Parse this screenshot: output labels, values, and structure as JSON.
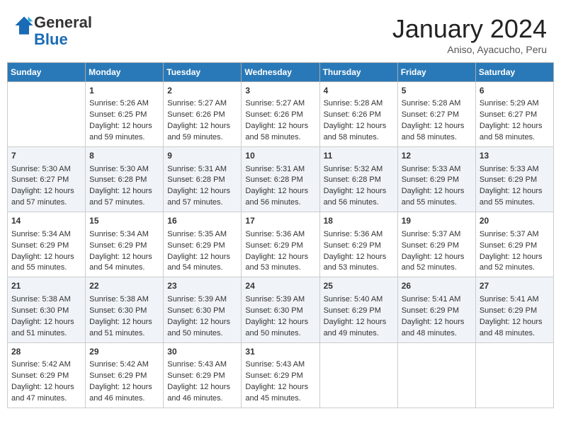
{
  "header": {
    "logo_general": "General",
    "logo_blue": "Blue",
    "month_title": "January 2024",
    "subtitle": "Aniso, Ayacucho, Peru"
  },
  "days_of_week": [
    "Sunday",
    "Monday",
    "Tuesday",
    "Wednesday",
    "Thursday",
    "Friday",
    "Saturday"
  ],
  "weeks": [
    [
      {
        "day": "",
        "info": ""
      },
      {
        "day": "1",
        "info": "Sunrise: 5:26 AM\nSunset: 6:25 PM\nDaylight: 12 hours\nand 59 minutes."
      },
      {
        "day": "2",
        "info": "Sunrise: 5:27 AM\nSunset: 6:26 PM\nDaylight: 12 hours\nand 59 minutes."
      },
      {
        "day": "3",
        "info": "Sunrise: 5:27 AM\nSunset: 6:26 PM\nDaylight: 12 hours\nand 58 minutes."
      },
      {
        "day": "4",
        "info": "Sunrise: 5:28 AM\nSunset: 6:26 PM\nDaylight: 12 hours\nand 58 minutes."
      },
      {
        "day": "5",
        "info": "Sunrise: 5:28 AM\nSunset: 6:27 PM\nDaylight: 12 hours\nand 58 minutes."
      },
      {
        "day": "6",
        "info": "Sunrise: 5:29 AM\nSunset: 6:27 PM\nDaylight: 12 hours\nand 58 minutes."
      }
    ],
    [
      {
        "day": "7",
        "info": "Sunrise: 5:30 AM\nSunset: 6:27 PM\nDaylight: 12 hours\nand 57 minutes."
      },
      {
        "day": "8",
        "info": "Sunrise: 5:30 AM\nSunset: 6:28 PM\nDaylight: 12 hours\nand 57 minutes."
      },
      {
        "day": "9",
        "info": "Sunrise: 5:31 AM\nSunset: 6:28 PM\nDaylight: 12 hours\nand 57 minutes."
      },
      {
        "day": "10",
        "info": "Sunrise: 5:31 AM\nSunset: 6:28 PM\nDaylight: 12 hours\nand 56 minutes."
      },
      {
        "day": "11",
        "info": "Sunrise: 5:32 AM\nSunset: 6:28 PM\nDaylight: 12 hours\nand 56 minutes."
      },
      {
        "day": "12",
        "info": "Sunrise: 5:33 AM\nSunset: 6:29 PM\nDaylight: 12 hours\nand 55 minutes."
      },
      {
        "day": "13",
        "info": "Sunrise: 5:33 AM\nSunset: 6:29 PM\nDaylight: 12 hours\nand 55 minutes."
      }
    ],
    [
      {
        "day": "14",
        "info": "Sunrise: 5:34 AM\nSunset: 6:29 PM\nDaylight: 12 hours\nand 55 minutes."
      },
      {
        "day": "15",
        "info": "Sunrise: 5:34 AM\nSunset: 6:29 PM\nDaylight: 12 hours\nand 54 minutes."
      },
      {
        "day": "16",
        "info": "Sunrise: 5:35 AM\nSunset: 6:29 PM\nDaylight: 12 hours\nand 54 minutes."
      },
      {
        "day": "17",
        "info": "Sunrise: 5:36 AM\nSunset: 6:29 PM\nDaylight: 12 hours\nand 53 minutes."
      },
      {
        "day": "18",
        "info": "Sunrise: 5:36 AM\nSunset: 6:29 PM\nDaylight: 12 hours\nand 53 minutes."
      },
      {
        "day": "19",
        "info": "Sunrise: 5:37 AM\nSunset: 6:29 PM\nDaylight: 12 hours\nand 52 minutes."
      },
      {
        "day": "20",
        "info": "Sunrise: 5:37 AM\nSunset: 6:29 PM\nDaylight: 12 hours\nand 52 minutes."
      }
    ],
    [
      {
        "day": "21",
        "info": "Sunrise: 5:38 AM\nSunset: 6:30 PM\nDaylight: 12 hours\nand 51 minutes."
      },
      {
        "day": "22",
        "info": "Sunrise: 5:38 AM\nSunset: 6:30 PM\nDaylight: 12 hours\nand 51 minutes."
      },
      {
        "day": "23",
        "info": "Sunrise: 5:39 AM\nSunset: 6:30 PM\nDaylight: 12 hours\nand 50 minutes."
      },
      {
        "day": "24",
        "info": "Sunrise: 5:39 AM\nSunset: 6:30 PM\nDaylight: 12 hours\nand 50 minutes."
      },
      {
        "day": "25",
        "info": "Sunrise: 5:40 AM\nSunset: 6:29 PM\nDaylight: 12 hours\nand 49 minutes."
      },
      {
        "day": "26",
        "info": "Sunrise: 5:41 AM\nSunset: 6:29 PM\nDaylight: 12 hours\nand 48 minutes."
      },
      {
        "day": "27",
        "info": "Sunrise: 5:41 AM\nSunset: 6:29 PM\nDaylight: 12 hours\nand 48 minutes."
      }
    ],
    [
      {
        "day": "28",
        "info": "Sunrise: 5:42 AM\nSunset: 6:29 PM\nDaylight: 12 hours\nand 47 minutes."
      },
      {
        "day": "29",
        "info": "Sunrise: 5:42 AM\nSunset: 6:29 PM\nDaylight: 12 hours\nand 46 minutes."
      },
      {
        "day": "30",
        "info": "Sunrise: 5:43 AM\nSunset: 6:29 PM\nDaylight: 12 hours\nand 46 minutes."
      },
      {
        "day": "31",
        "info": "Sunrise: 5:43 AM\nSunset: 6:29 PM\nDaylight: 12 hours\nand 45 minutes."
      },
      {
        "day": "",
        "info": ""
      },
      {
        "day": "",
        "info": ""
      },
      {
        "day": "",
        "info": ""
      }
    ]
  ]
}
